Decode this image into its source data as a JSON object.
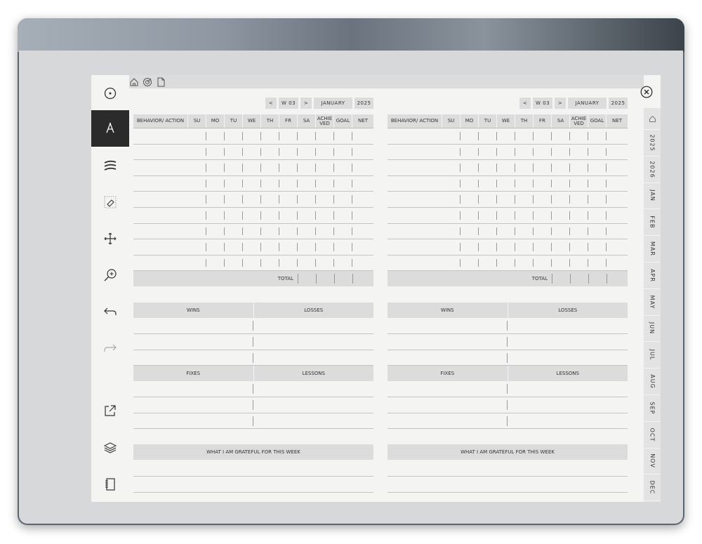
{
  "topbar": {
    "icons": [
      "home-icon",
      "target-icon",
      "page-icon"
    ]
  },
  "toolbar": {
    "tools": [
      "pen-selector-icon",
      "marker-icon",
      "menu-lines-icon",
      "eraser-icon",
      "move-icon",
      "zoom-icon",
      "undo-icon",
      "redo-icon",
      "export-icon",
      "layers-icon",
      "notebook-icon"
    ]
  },
  "nav": {
    "prev": "<",
    "week": "W 03",
    "next": ">",
    "month": "JANUARY",
    "year": "2025"
  },
  "table": {
    "columns": [
      "BEHAVIOR/ ACTION",
      "SU",
      "MO",
      "TU",
      "WE",
      "TH",
      "FR",
      "SA",
      "ACHIE VED",
      "GOAL",
      "NET"
    ],
    "total_label": "TOTAL"
  },
  "sections": {
    "wins": "WINS",
    "losses": "LOSSES",
    "fixes": "FIXES",
    "lessons": "LESSONS",
    "grateful": "WHAT I AM GRATEFUL FOR THIS WEEK"
  },
  "tabs": [
    "2025",
    "2026",
    "JAN",
    "FEB",
    "MAR",
    "APR",
    "MAY",
    "JUN",
    "JUL",
    "AUG",
    "SEP",
    "OCT",
    "NOV",
    "DEC"
  ]
}
